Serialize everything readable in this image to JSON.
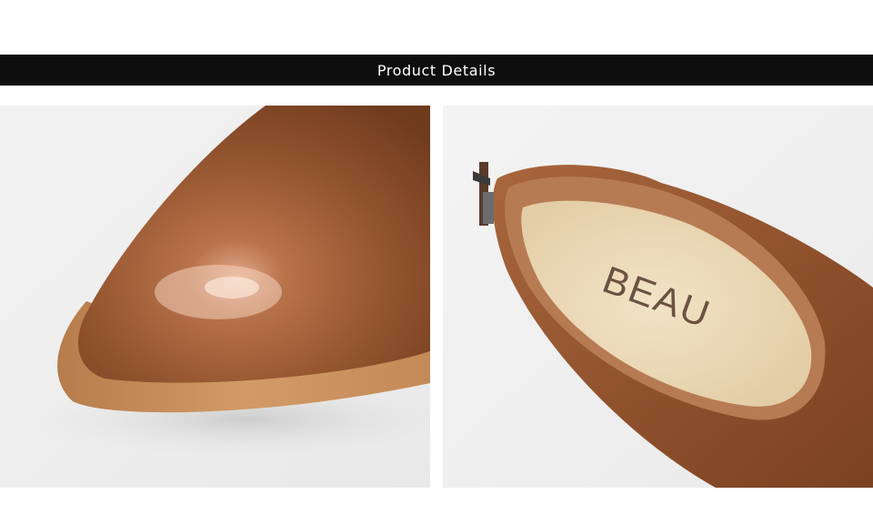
{
  "banner": {
    "title": "Product Details"
  },
  "photos": [
    {
      "subject": "shoe-toe-closeup"
    },
    {
      "subject": "shoe-heel-interior",
      "insole_brand": "BEAU"
    }
  ],
  "colors": {
    "banner_bg": "#0e0e0e",
    "banner_text": "#ffffff",
    "leather": "#9a5a32",
    "sole": "#c98d5a",
    "insole": "#eedcbc",
    "backdrop": "#f3f3f3"
  }
}
